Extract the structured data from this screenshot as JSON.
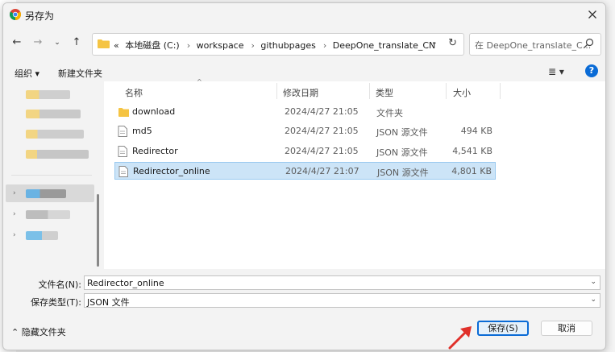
{
  "window": {
    "title": "另存为"
  },
  "nav": {
    "path": [
      "本地磁盘 (C:)",
      "workspace",
      "githubpages",
      "DeepOne_translate_CN"
    ],
    "overflow": "«"
  },
  "search": {
    "placeholder": "在 DeepOne_translate_C..."
  },
  "toolbar": {
    "organize": "组织 ▾",
    "new_folder": "新建文件夹"
  },
  "columns": {
    "name": "名称",
    "date": "修改日期",
    "type": "类型",
    "size": "大小"
  },
  "files": [
    {
      "name": "download",
      "date": "2024/4/27 21:05",
      "type": "文件夹",
      "size": "",
      "icon": "folder-icon"
    },
    {
      "name": "md5",
      "date": "2024/4/27 21:05",
      "type": "JSON 源文件",
      "size": "494 KB",
      "icon": "file-icon"
    },
    {
      "name": "Redirector",
      "date": "2024/4/27 21:05",
      "type": "JSON 源文件",
      "size": "4,541 KB",
      "icon": "file-icon"
    },
    {
      "name": "Redirector_online",
      "date": "2024/4/27 21:07",
      "type": "JSON 源文件",
      "size": "4,801 KB",
      "icon": "file-icon",
      "selected": true
    }
  ],
  "form": {
    "filename_label": "文件名(N):",
    "filename_value": "Redirector_online",
    "filetype_label": "保存类型(T):",
    "filetype_value": "JSON 文件"
  },
  "footer": {
    "hide_folders": "隐藏文件夹",
    "save_label": "保存(S)",
    "cancel_label": "取消"
  },
  "colors": {
    "accent": "#0a6bd6",
    "selection": "#cce4f7",
    "folder": "#f5c443",
    "annotation_arrow": "#e0302a"
  }
}
